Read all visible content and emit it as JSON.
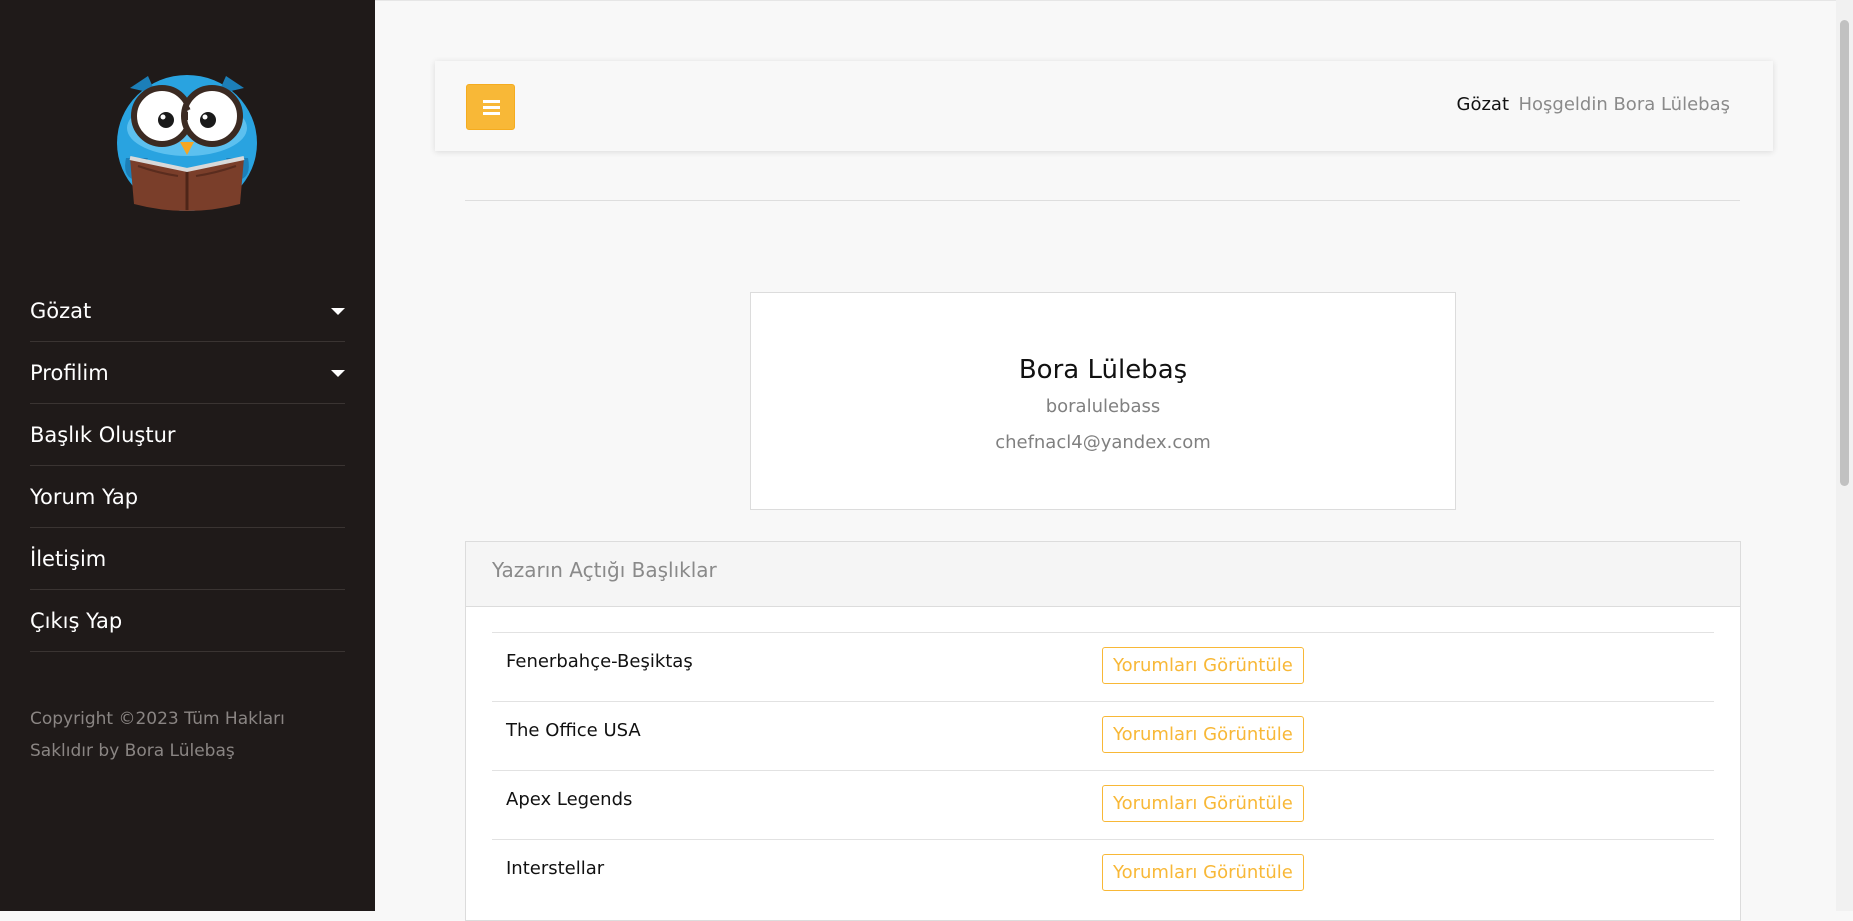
{
  "sidebar": {
    "menu": [
      {
        "label": "Gözat",
        "has_dropdown": true
      },
      {
        "label": "Profilim",
        "has_dropdown": true
      },
      {
        "label": "Başlık Oluştur",
        "has_dropdown": false
      },
      {
        "label": "Yorum Yap",
        "has_dropdown": false
      },
      {
        "label": "İletişim",
        "has_dropdown": false
      },
      {
        "label": "Çıkış Yap",
        "has_dropdown": false
      }
    ],
    "copyright_line1": "Copyright ©2023 Tüm Hakları",
    "copyright_line2": "Saklıdır by Bora Lülebaş"
  },
  "topbar": {
    "menu_icon": "hamburger-icon",
    "nav_browse": "Gözat",
    "nav_welcome": "Hoşgeldin Bora Lülebaş"
  },
  "profile": {
    "name": "Bora Lülebaş",
    "username": "boralulebass",
    "email": "chefnacl4@yandex.com"
  },
  "topics": {
    "header": "Yazarın Açtığı Başlıklar",
    "rows": [
      {
        "title": "Fenerbahçe-Beşiktaş",
        "button": "Yorumları Görüntüle"
      },
      {
        "title": "The Office USA",
        "button": "Yorumları Görüntüle"
      },
      {
        "title": "Apex Legends",
        "button": "Yorumları Görüntüle"
      },
      {
        "title": "Interstellar",
        "button": "Yorumları Görüntüle"
      }
    ]
  },
  "colors": {
    "sidebar_bg": "#1f1a19",
    "accent": "#f8b837",
    "owl_blue": "#29a3e0",
    "book_brown": "#7a3e2a"
  }
}
